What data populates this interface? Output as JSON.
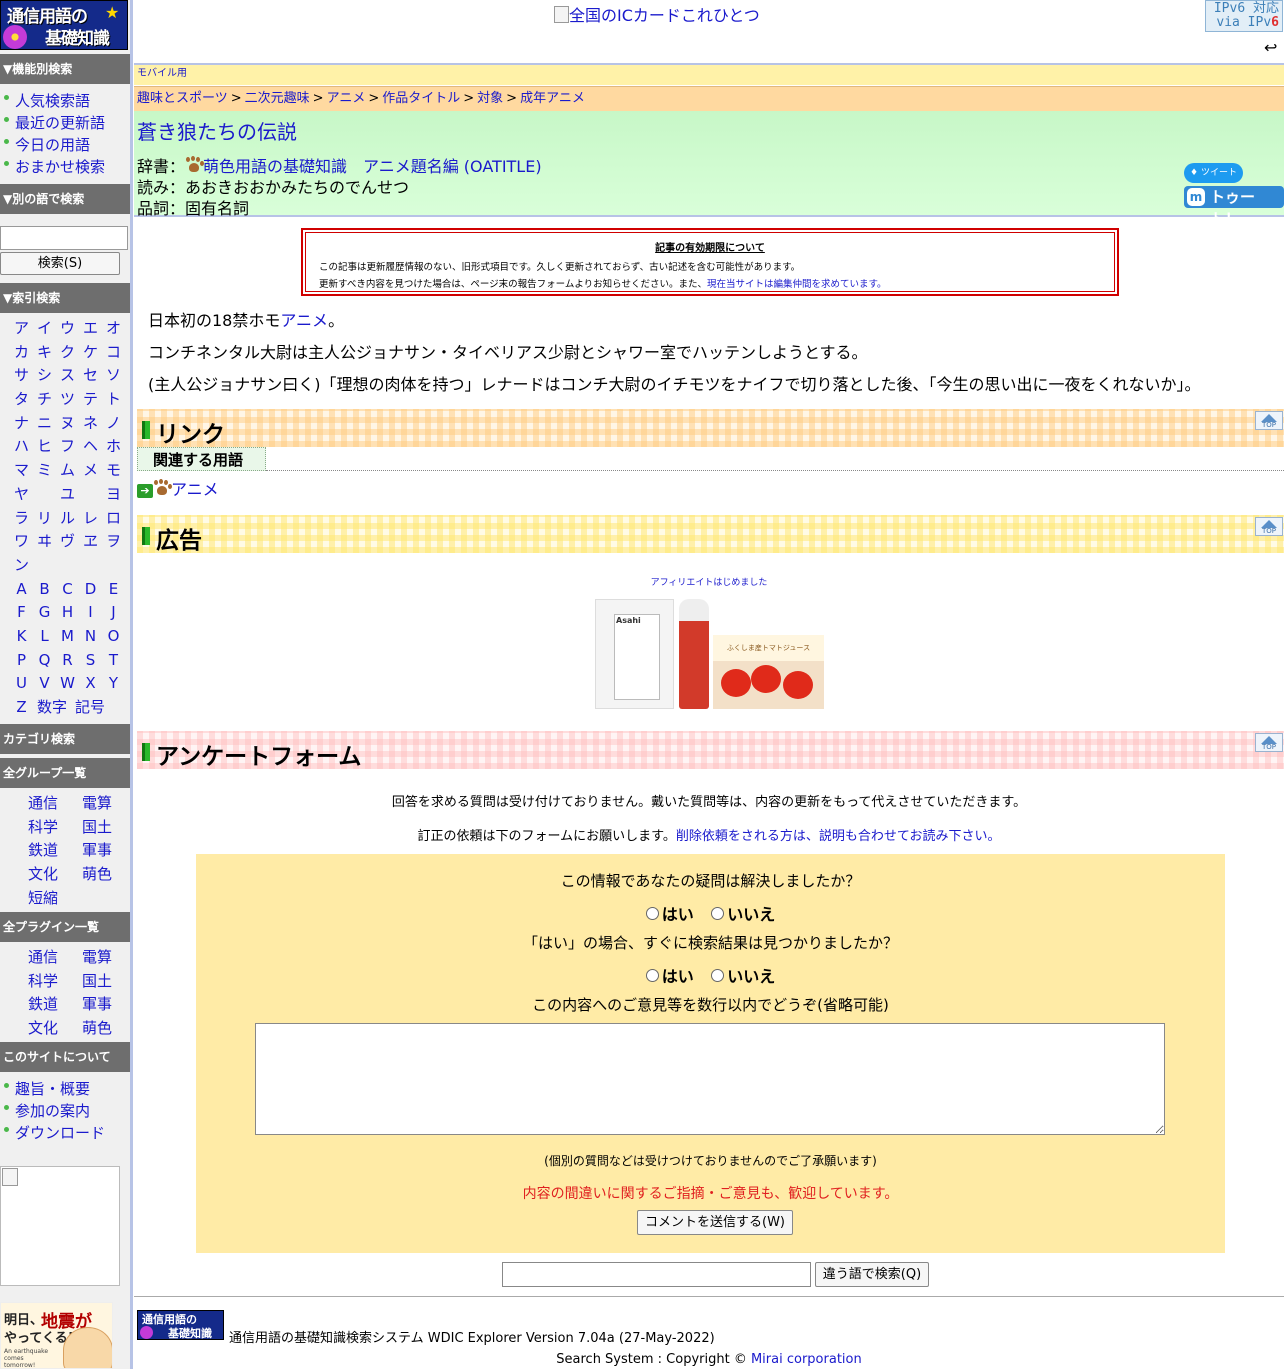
{
  "site": {
    "logo_line1": "通信用語の",
    "logo_line2": "基礎知識"
  },
  "top": {
    "banner_alt": "全国のICカードこれひとつ",
    "ipv6_line1": "IPv6 対応",
    "ipv6_line2_prefix": "via IPv",
    "ipv6_line2_suffix": "6",
    "back_icon": "↩"
  },
  "sidebar": {
    "function_search_heading": "▼機能別検索",
    "function_items": [
      "人気検索語",
      "最近の更新語",
      "今日の用語",
      "おまかせ検索"
    ],
    "other_search_heading": "▼別の語で検索",
    "search_input_value": "",
    "search_button": "検索(S)",
    "index_heading": "▼索引検索",
    "kana_rows": [
      [
        "ア",
        "イ",
        "ウ",
        "エ",
        "オ"
      ],
      [
        "カ",
        "キ",
        "ク",
        "ケ",
        "コ"
      ],
      [
        "サ",
        "シ",
        "ス",
        "セ",
        "ソ"
      ],
      [
        "タ",
        "チ",
        "ツ",
        "テ",
        "ト"
      ],
      [
        "ナ",
        "ニ",
        "ヌ",
        "ネ",
        "ノ"
      ],
      [
        "ハ",
        "ヒ",
        "フ",
        "ヘ",
        "ホ"
      ],
      [
        "マ",
        "ミ",
        "ム",
        "メ",
        "モ"
      ],
      [
        "ヤ",
        "",
        "ユ",
        "",
        "ヨ"
      ],
      [
        "ラ",
        "リ",
        "ル",
        "レ",
        "ロ"
      ],
      [
        "ワ",
        "ヰ",
        "ヴ",
        "ヱ",
        "ヲ"
      ],
      [
        "ン",
        "",
        "",
        "",
        ""
      ],
      [
        "A",
        "B",
        "C",
        "D",
        "E"
      ],
      [
        "F",
        "G",
        "H",
        "I",
        "J"
      ],
      [
        "K",
        "L",
        "M",
        "N",
        "O"
      ],
      [
        "P",
        "Q",
        "R",
        "S",
        "T"
      ],
      [
        "U",
        "V",
        "W",
        "X",
        "Y"
      ]
    ],
    "last_index_row": [
      "Z",
      "数字",
      "記号"
    ],
    "category_heading": "カテゴリ検索",
    "group_heading": "全グループ一覧",
    "groups": [
      "通信",
      "電算",
      "科学",
      "国土",
      "鉄道",
      "軍事",
      "文化",
      "萌色",
      "短縮"
    ],
    "plugin_heading": "全プラグイン一覧",
    "plugins": [
      "通信",
      "電算",
      "科学",
      "国土",
      "鉄道",
      "軍事",
      "文化",
      "萌色"
    ],
    "about_heading": "このサイトについて",
    "about_items": [
      "趣旨・概要",
      "参加の案内",
      "ダウンロード"
    ],
    "banner_line1": "明日、",
    "banner_line2": "地震が",
    "banner_line3": "やってくる!",
    "banner_small": "An earthquake comes tomorrow!"
  },
  "main": {
    "mobile_link": "モバイル用",
    "breadcrumb": [
      "趣味とスポーツ",
      "二次元趣味",
      "アニメ",
      "作品タイトル",
      "対象",
      "成年アニメ"
    ],
    "breadcrumb_sep": ">",
    "title": "蒼き狼たちの伝説",
    "dict_label": "辞書：",
    "dict_value": "萌色用語の基礎知識　アニメ題名編 (OATITLE)",
    "reading_label": "読み：",
    "reading_value": "あおきおおかみたちのでんせつ",
    "pos_label": "品詞：",
    "pos_value": "固有名詞",
    "tweet_label": "ツイート",
    "toot_label": "トゥート！",
    "notice": {
      "title": "記事の有効期限について",
      "line1": "この記事は更新履歴情報のない、旧形式項目です。久しく更新されておらず、古い記述を含む可能性があります。",
      "line2": "更新すべき内容を見つけた場合は、ページ末の報告フォームよりお知らせください。また、",
      "line2_link": "現在当サイトは編集仲間を求めています。"
    },
    "body": {
      "p1_prefix": "日本初の18禁ホモ",
      "p1_link": "アニメ",
      "p1_suffix": "。",
      "p2": "コンチネンタル大尉は主人公ジョナサン・タイベリアス少尉とシャワー室でハッテンしようとする。",
      "p3": "(主人公ジョナサン曰く)「理想の肉体を持つ」レナードはコンチ大尉のイチモツをナイフで切り落とした後、「今生の思い出に一夜をくれないか」。"
    },
    "links_heading": "リンク",
    "related_tab": "関連する用語",
    "related_item": "アニメ",
    "ad_heading": "広告",
    "affiliate_text": "アフィリエイトはじめました",
    "ad_brand": "Asahi",
    "ad_product3_label": "ふくしま産トマトジュース",
    "survey_heading": "アンケートフォーム",
    "top_button": "TOP",
    "survey": {
      "intro1": "回答を求める質問は受け付けておりません。戴いた質問等は、内容の更新をもって代えさせていただきます。",
      "intro2_prefix": "訂正の依頼は下のフォームにお願いします。",
      "intro2_link": "削除依頼をされる方は、説明も合わせてお読み下さい。",
      "q1": "この情報であなたの疑問は解決しましたか？",
      "q2": "「はい」の場合、すぐに検索結果は見つかりましたか？",
      "yes": "はい",
      "no": "いいえ",
      "q3": "この内容へのご意見等を数行以内でどうぞ(省略可能)",
      "comment_value": "",
      "note": "(個別の質問などは受けつけておりませんのでご了承願います)",
      "welcome": "内容の間違いに関するご指摘・ご意見も、歓迎しています。",
      "submit": "コメントを送信する(W)"
    },
    "bottom_search_value": "",
    "bottom_search_button": "違う語で検索(Q)",
    "footer_logo_line1": "通信用語の",
    "footer_logo_line2": "基礎知識",
    "footer_system": "通信用語の基礎知識検索システム WDIC Explorer Version 7.04a (27-May-2022)",
    "footer_copyright_prefix": "Search System : Copyright © ",
    "footer_copyright_link": "Mirai corporation"
  }
}
